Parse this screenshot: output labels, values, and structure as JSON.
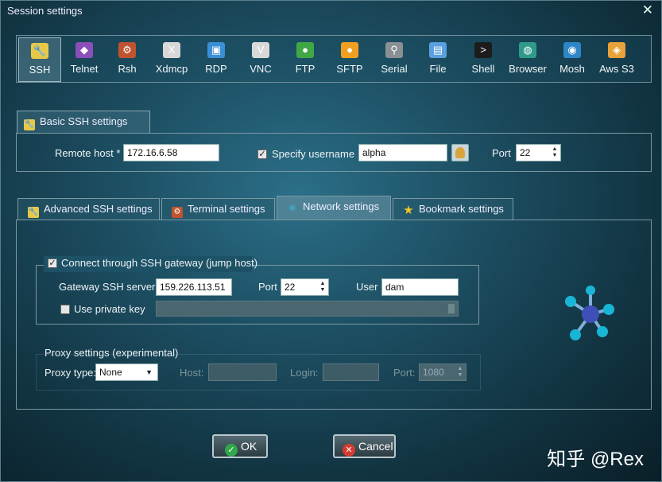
{
  "window": {
    "title": "Session settings",
    "close_glyph": "✕"
  },
  "toolbar": {
    "items": [
      {
        "label": "SSH",
        "icon": "wrench-icon",
        "color": "#e7c94a",
        "glyph": "🔧",
        "active": true
      },
      {
        "label": "Telnet",
        "icon": "telnet-icon",
        "color": "#8a4fb8",
        "glyph": "◆"
      },
      {
        "label": "Rsh",
        "icon": "rsh-icon",
        "color": "#c0532f",
        "glyph": "⚙"
      },
      {
        "label": "Xdmcp",
        "icon": "xdmcp-icon",
        "color": "#d8d8d8",
        "glyph": "X"
      },
      {
        "label": "RDP",
        "icon": "rdp-icon",
        "color": "#3b8fd6",
        "glyph": "▣"
      },
      {
        "label": "VNC",
        "icon": "vnc-icon",
        "color": "#d9d9d9",
        "glyph": "V"
      },
      {
        "label": "FTP",
        "icon": "ftp-icon",
        "color": "#3fa845",
        "glyph": "●"
      },
      {
        "label": "SFTP",
        "icon": "sftp-icon",
        "color": "#f0a020",
        "glyph": "●"
      },
      {
        "label": "Serial",
        "icon": "serial-icon",
        "color": "#8a8f94",
        "glyph": "⚲"
      },
      {
        "label": "File",
        "icon": "file-icon",
        "color": "#5a9fe0",
        "glyph": "▤"
      },
      {
        "label": "Shell",
        "icon": "shell-icon",
        "color": "#1c1c1c",
        "glyph": ">"
      },
      {
        "label": "Browser",
        "icon": "globe-icon",
        "color": "#2f9a8a",
        "glyph": "◍"
      },
      {
        "label": "Mosh",
        "icon": "mosh-icon",
        "color": "#2d86c8",
        "glyph": "◉"
      },
      {
        "label": "Aws S3",
        "icon": "aws-s3-icon",
        "color": "#e8a23a",
        "glyph": "◈"
      }
    ]
  },
  "basic": {
    "tab_label": "Basic SSH settings",
    "remote_host_label": "Remote host *",
    "remote_host_value": "172.16.6.58",
    "specify_username_label": "Specify username",
    "specify_username_checked": true,
    "username_value": "alpha",
    "port_label": "Port",
    "port_value": "22"
  },
  "tabs": [
    {
      "label": "Advanced SSH settings",
      "icon": "wrench-icon",
      "active": false
    },
    {
      "label": "Terminal settings",
      "icon": "terminal-icon",
      "active": false
    },
    {
      "label": "Network settings",
      "icon": "network-icon",
      "active": true
    },
    {
      "label": "Bookmark settings",
      "icon": "star-icon",
      "active": false
    }
  ],
  "network": {
    "gateway_label": "Connect through SSH gateway (jump host)",
    "gateway_checked": true,
    "gateway_server_label": "Gateway SSH server",
    "gateway_server_value": "159.226.113.51",
    "gw_port_label": "Port",
    "gw_port_value": "22",
    "user_label": "User",
    "user_value": "dam",
    "private_key_label": "Use private key",
    "private_key_checked": false,
    "proxy_title": "Proxy settings (experimental)",
    "proxy_type_label": "Proxy type:",
    "proxy_type_value": "None",
    "host_label": "Host:",
    "login_label": "Login:",
    "proxy_port_label": "Port:",
    "proxy_port_value": "1080"
  },
  "buttons": {
    "ok": "OK",
    "cancel": "Cancel"
  },
  "watermark": "知乎 @Rex"
}
